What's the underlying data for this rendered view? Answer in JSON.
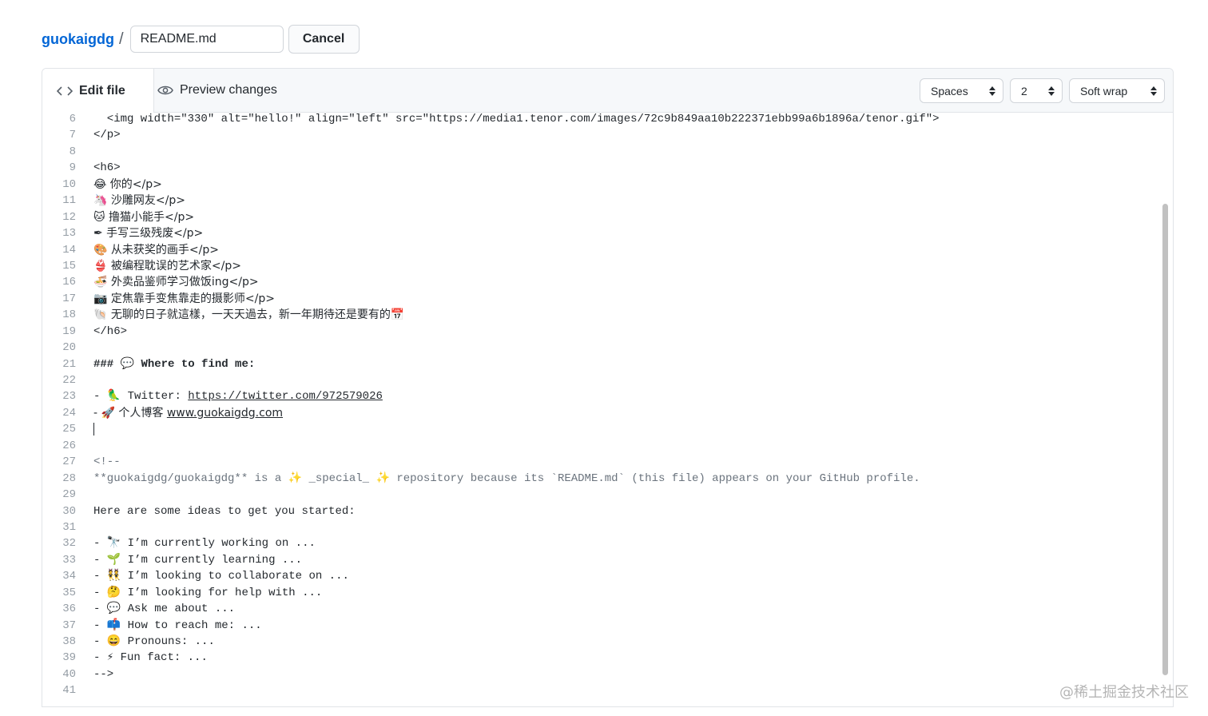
{
  "breadcrumb": {
    "owner": "guokaigdg",
    "separator": "/",
    "filename": "README.md",
    "cancel_label": "Cancel"
  },
  "tabs": {
    "edit_label": "Edit file",
    "preview_label": "Preview changes"
  },
  "options": {
    "indent_mode": "Spaces",
    "indent_size": "2",
    "wrap_mode": "Soft wrap"
  },
  "code_lines": [
    {
      "n": "6",
      "t": "  <img width=\"330\" alt=\"hello!\" align=\"left\" src=\"https://media1.tenor.com/images/72c9b849aa10b222371ebb99a6b1896a/tenor.gif\">"
    },
    {
      "n": "7",
      "t": "</p>"
    },
    {
      "n": "8",
      "t": ""
    },
    {
      "n": "9",
      "t": "<h6>"
    },
    {
      "n": "10",
      "t": "😂 你的</p>"
    },
    {
      "n": "11",
      "t": "🦄 沙雕网友</p>"
    },
    {
      "n": "12",
      "t": "🐱 撸猫小能手</p>"
    },
    {
      "n": "13",
      "t": "✒ 手写三级残废</p>"
    },
    {
      "n": "14",
      "t": "🎨 从未获奖的画手</p>"
    },
    {
      "n": "15",
      "t": "👙 被编程耽误的艺术家</p>"
    },
    {
      "n": "16",
      "t": "🍜 外卖品鉴师学习做饭ing</p>"
    },
    {
      "n": "17",
      "t": "📷 定焦靠手变焦靠走的摄影师</p>"
    },
    {
      "n": "18",
      "t": "🐚 无聊的日子就這樣，一天天過去，新一年期待还是要有的📅"
    },
    {
      "n": "19",
      "t": "</h6>"
    },
    {
      "n": "20",
      "t": ""
    },
    {
      "n": "21",
      "t": "### 💬 Where to find me:"
    },
    {
      "n": "22",
      "t": ""
    },
    {
      "n": "23",
      "t": "- 🦜 Twitter: ",
      "link": "https://twitter.com/972579026"
    },
    {
      "n": "24",
      "t": "- 🚀 个人博客 ",
      "link": "www.guokaigdg.com"
    },
    {
      "n": "25",
      "t": ""
    },
    {
      "n": "26",
      "t": ""
    },
    {
      "n": "27",
      "t": "<!--"
    },
    {
      "n": "28",
      "t": "**guokaigdg/guokaigdg** is a ✨ _special_ ✨ repository because its `README.md` (this file) appears on your GitHub profile."
    },
    {
      "n": "29",
      "t": ""
    },
    {
      "n": "30",
      "t": "Here are some ideas to get you started:"
    },
    {
      "n": "31",
      "t": ""
    },
    {
      "n": "32",
      "t": "- 🔭 I’m currently working on ..."
    },
    {
      "n": "33",
      "t": "- 🌱 I’m currently learning ..."
    },
    {
      "n": "34",
      "t": "- 👯 I’m looking to collaborate on ..."
    },
    {
      "n": "35",
      "t": "- 🤔 I’m looking for help with ..."
    },
    {
      "n": "36",
      "t": "- 💬 Ask me about ..."
    },
    {
      "n": "37",
      "t": "- 📫 How to reach me: ..."
    },
    {
      "n": "38",
      "t": "- 😄 Pronouns: ..."
    },
    {
      "n": "39",
      "t": "- ⚡ Fun fact: ..."
    },
    {
      "n": "40",
      "t": "-->"
    },
    {
      "n": "41",
      "t": ""
    }
  ],
  "watermark": "@稀土掘金技术社区",
  "colors": {
    "link": "#0366d6",
    "border": "#e1e4e8",
    "tab_bg": "#f6f8fa",
    "line_number": "#959da5"
  }
}
